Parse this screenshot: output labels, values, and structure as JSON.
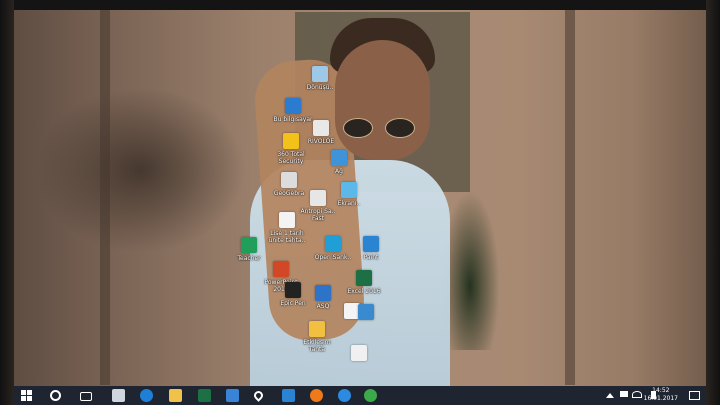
{
  "desktop": {
    "icons": [
      {
        "name": "recycle-bin-icon",
        "label": "Dönüşü..",
        "color": "#9ec8e8"
      },
      {
        "name": "this-pc-icon",
        "label": "Bu bilgisayar",
        "color": "#2b7bd0"
      },
      {
        "name": "folder-icon",
        "label": "RIVOLOE",
        "color": "#e8e8e8"
      },
      {
        "name": "360-total-security-icon",
        "label": "360 Total\nSecurity",
        "color": "#f2c21b"
      },
      {
        "name": "network-icon",
        "label": "Ağ",
        "color": "#3f93d8"
      },
      {
        "name": "geogebra-icon",
        "label": "GeoGebra",
        "color": "#dcdcdc"
      },
      {
        "name": "antropi-icon",
        "label": "Antropi Sa..\nFast",
        "color": "#e6e6e6"
      },
      {
        "name": "monitor-icon",
        "label": "Ekranı..",
        "color": "#5bb8e8"
      },
      {
        "name": "file-icon",
        "label": "Lise 1 tarih\nünite tahta..",
        "color": "#f3f3f3"
      },
      {
        "name": "publisher-icon",
        "label": "Teacher",
        "color": "#1f9f5a"
      },
      {
        "name": "open-sankore-icon",
        "label": "Open Sank..",
        "color": "#1f9fd6"
      },
      {
        "name": "paint-icon",
        "label": "Paint",
        "color": "#2a84d2"
      },
      {
        "name": "powerpoint-icon",
        "label": "PowerPoint\n2016",
        "color": "#d24726"
      },
      {
        "name": "excel-icon",
        "label": "Excel 2016",
        "color": "#1d7044"
      },
      {
        "name": "epic-pen-icon",
        "label": "Epic Pen",
        "color": "#222222"
      },
      {
        "name": "asq-icon",
        "label": "ASQ",
        "color": "#2d74c8"
      },
      {
        "name": "shortcut-icon",
        "label": "",
        "color": "#f4f4f4"
      },
      {
        "name": "tool-icon",
        "label": "",
        "color": "#3a8ad0"
      },
      {
        "name": "ebooks-icon",
        "label": "Etkileşim\nTahta",
        "color": "#f2c040"
      },
      {
        "name": "document-icon",
        "label": "",
        "color": "#f0f0f0"
      }
    ]
  },
  "taskbar": {
    "apps": [
      {
        "name": "search-icon",
        "color": "#ffffff"
      },
      {
        "name": "task-view-icon",
        "color": "#ffffff"
      },
      {
        "name": "app-icon",
        "color": "#cfd6e0"
      },
      {
        "name": "edge-icon",
        "color": "#1e7fd8"
      },
      {
        "name": "file-explorer-icon",
        "color": "#f0c24a"
      },
      {
        "name": "excel-taskbar-icon",
        "color": "#1d7044"
      },
      {
        "name": "store-icon",
        "color": "#3a84d8"
      },
      {
        "name": "maps-icon",
        "color": "#ffffff"
      },
      {
        "name": "app-taskbar-icon",
        "color": "#2a84d2"
      },
      {
        "name": "firefox-icon",
        "color": "#f07a1a"
      },
      {
        "name": "internet-explorer-icon",
        "color": "#2c8ae0"
      },
      {
        "name": "chrome-icon",
        "color": "#3aaa4a"
      }
    ],
    "clock": {
      "time": "14:52",
      "date": "16.01.2017"
    }
  }
}
